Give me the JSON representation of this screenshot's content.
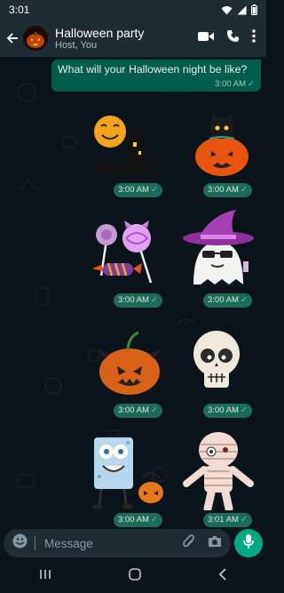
{
  "status_bar": {
    "time": "3:01"
  },
  "header": {
    "title": "Halloween party",
    "subtitle": "Host, You",
    "icons": [
      "back-arrow-icon",
      "video-call-icon",
      "voice-call-icon",
      "more-vertical-icon"
    ]
  },
  "messages": [
    {
      "type": "text",
      "text": "What will your Halloween night be like?",
      "time": "3:00 AM"
    }
  ],
  "stickers": [
    {
      "name": "haunted-house-moon-sticker",
      "time": "3:00 AM"
    },
    {
      "name": "cat-pumpkin-sticker",
      "time": "3:00 AM"
    },
    {
      "name": "candy-lollipops-sticker",
      "time": "3:00 AM"
    },
    {
      "name": "witch-ghost-sticker",
      "time": "3:00 AM"
    },
    {
      "name": "devil-pumpkin-sticker",
      "time": "3:00 AM"
    },
    {
      "name": "skull-sticker",
      "time": "3:00 AM"
    },
    {
      "name": "sponge-pumpkin-sticker",
      "time": "3:00 AM"
    },
    {
      "name": "mummy-sticker",
      "time": "3:01 AM"
    }
  ],
  "input": {
    "placeholder": "Message"
  },
  "colors": {
    "accent": "#00a884",
    "bubble_out": "#005c4b",
    "header_bg": "#1f2c34",
    "read_tick": "#53bdeb"
  }
}
